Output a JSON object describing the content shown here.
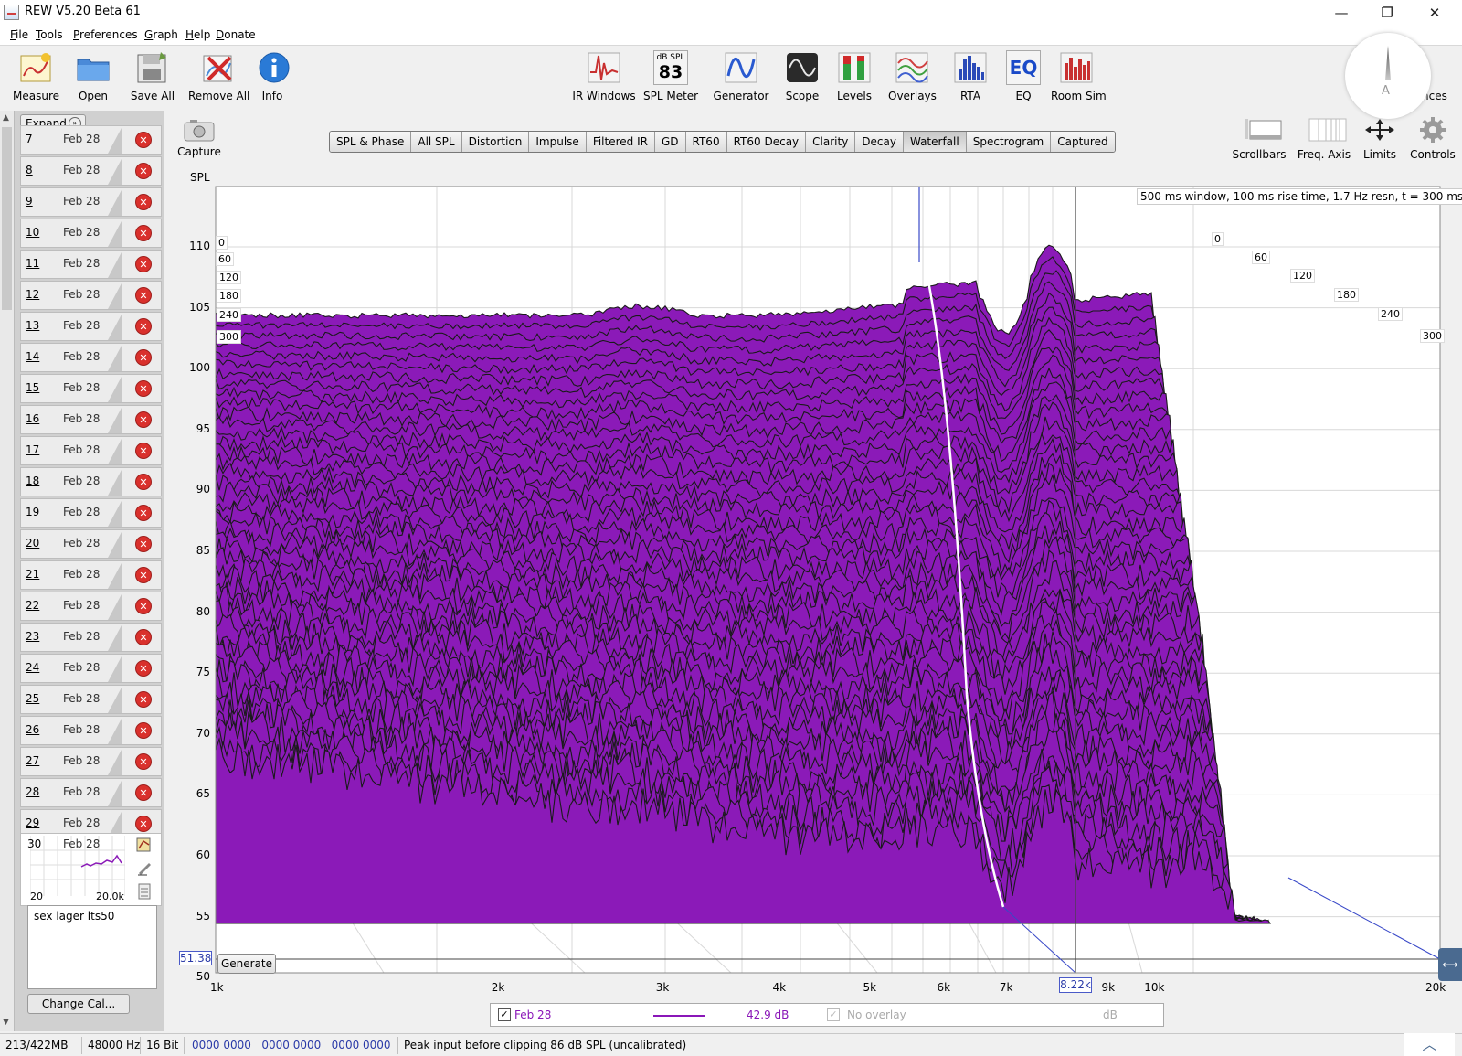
{
  "window": {
    "title": "REW V5.20 Beta 61",
    "minimize": "—",
    "restore": "❐",
    "close": "✕"
  },
  "menu": [
    "File",
    "Tools",
    "Preferences",
    "Graph",
    "Help",
    "Donate"
  ],
  "toolbar_left": [
    {
      "label": "Measure",
      "icon": "measure-icon"
    },
    {
      "label": "Open",
      "icon": "folder-icon"
    },
    {
      "label": "Save All",
      "icon": "save-icon"
    },
    {
      "label": "Remove All",
      "icon": "remove-all-icon"
    },
    {
      "label": "Info",
      "icon": "info-icon"
    }
  ],
  "toolbar_right": [
    {
      "label": "IR Windows",
      "icon": "ir-windows-icon"
    },
    {
      "label": "SPL Meter",
      "icon": "spl-meter-icon",
      "reading_unit": "dB SPL",
      "reading": "83"
    },
    {
      "label": "Generator",
      "icon": "generator-icon"
    },
    {
      "label": "Scope",
      "icon": "scope-icon"
    },
    {
      "label": "Levels",
      "icon": "levels-icon"
    },
    {
      "label": "Overlays",
      "icon": "overlays-icon"
    },
    {
      "label": "RTA",
      "icon": "rta-icon"
    },
    {
      "label": "EQ",
      "icon": "eq-icon",
      "glyph": "EQ"
    },
    {
      "label": "Room Sim",
      "icon": "room-sim-icon"
    }
  ],
  "preferences_partial": "nces",
  "spl_dial_weighting": "A",
  "measurements_panel": {
    "expand_label": "Expand",
    "rows": [
      {
        "num": "7",
        "date": "Feb 28"
      },
      {
        "num": "8",
        "date": "Feb 28"
      },
      {
        "num": "9",
        "date": "Feb 28"
      },
      {
        "num": "10",
        "date": "Feb 28"
      },
      {
        "num": "11",
        "date": "Feb 28"
      },
      {
        "num": "12",
        "date": "Feb 28"
      },
      {
        "num": "13",
        "date": "Feb 28"
      },
      {
        "num": "14",
        "date": "Feb 28"
      },
      {
        "num": "15",
        "date": "Feb 28"
      },
      {
        "num": "16",
        "date": "Feb 28"
      },
      {
        "num": "17",
        "date": "Feb 28"
      },
      {
        "num": "18",
        "date": "Feb 28"
      },
      {
        "num": "19",
        "date": "Feb 28"
      },
      {
        "num": "20",
        "date": "Feb 28"
      },
      {
        "num": "21",
        "date": "Feb 28"
      },
      {
        "num": "22",
        "date": "Feb 28"
      },
      {
        "num": "23",
        "date": "Feb 28"
      },
      {
        "num": "24",
        "date": "Feb 28"
      },
      {
        "num": "25",
        "date": "Feb 28"
      },
      {
        "num": "26",
        "date": "Feb 28"
      },
      {
        "num": "27",
        "date": "Feb 28"
      },
      {
        "num": "28",
        "date": "Feb 28"
      },
      {
        "num": "29",
        "date": "Feb 28"
      }
    ],
    "active": {
      "num": "30",
      "date": "Feb 28",
      "range_low": "20",
      "range_high": "20.0k"
    },
    "notes": "sex lager lts50",
    "change_cal_label": "Change Cal..."
  },
  "capture_label": "Capture",
  "graph_tabs": [
    {
      "label": "SPL & Phase",
      "active": false
    },
    {
      "label": "All SPL",
      "active": false
    },
    {
      "label": "Distortion",
      "active": false
    },
    {
      "label": "Impulse",
      "active": false
    },
    {
      "label": "Filtered IR",
      "active": false
    },
    {
      "label": "GD",
      "active": false
    },
    {
      "label": "RT60",
      "active": false
    },
    {
      "label": "RT60 Decay",
      "active": false
    },
    {
      "label": "Clarity",
      "active": false
    },
    {
      "label": "Decay",
      "active": false
    },
    {
      "label": "Waterfall",
      "active": true
    },
    {
      "label": "Spectrogram",
      "active": false
    },
    {
      "label": "Captured",
      "active": false
    }
  ],
  "graph_controls": [
    {
      "label": "Scrollbars",
      "icon": "scrollbars-icon"
    },
    {
      "label": "Freq. Axis",
      "icon": "freq-axis-icon"
    },
    {
      "label": "Limits",
      "icon": "limits-icon"
    },
    {
      "label": "Controls",
      "icon": "gear-icon"
    }
  ],
  "plot": {
    "y_axis_label": "SPL",
    "info_text": "500 ms window, 100 ms rise time,  1.7 Hz resn, t = 300 ms",
    "y_ticks": [
      "110",
      "105",
      "100",
      "95",
      "90",
      "85",
      "80",
      "75",
      "70",
      "65",
      "60",
      "55",
      "50"
    ],
    "x_ticks": [
      "1k",
      "2k",
      "3k",
      "4k",
      "5k",
      "6k",
      "7k",
      "9k",
      "10k",
      "20k"
    ],
    "time_ticks_left": [
      "0",
      "60",
      "120",
      "180",
      "240",
      "300"
    ],
    "time_ticks_right": [
      "0",
      "60",
      "120",
      "180",
      "240",
      "300"
    ],
    "cursor_spl": "51.38",
    "cursor_freq": "8.22k",
    "generate_label": "Generate",
    "fill_color": "#8b1ab8",
    "line_color": "#1a1a1a"
  },
  "legend": {
    "name": "Feb 28",
    "value": "42.9 dB",
    "overlay": "No overlay",
    "unit": "dB"
  },
  "status": {
    "memory": "213/422MB",
    "sample_rate": "48000 Hz",
    "bit_depth": "16 Bit",
    "levels": "0000 0000   0000 0000   0000 0000",
    "message": "Peak input before clipping 86 dB SPL (uncalibrated)"
  }
}
